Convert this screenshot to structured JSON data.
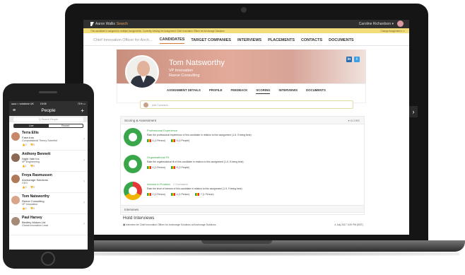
{
  "app": {
    "logo_prefix": "Aaron Wallis",
    "logo_accent": "Search",
    "user_name": "Caroline Richardson ▾",
    "notice": "This candidate is assigned to multiple Assignments. Currently viewing the Assignment Chief Innovation Officer for Anchorage Solutions",
    "change_assignment": "Change Assignment ▾",
    "close": "✕"
  },
  "nav": {
    "context": "Chief Innovation Officer for Anch...",
    "tabs": [
      "CANDIDATES",
      "TARGET COMPANIES",
      "INTERVIEWS",
      "PLACEMENTS",
      "CONTACTS",
      "DOCUMENTS"
    ]
  },
  "profile": {
    "name": "Tom Natsworthy",
    "role": "VP Innovation",
    "company": "Reeve Consulting",
    "linkedin": "in",
    "twitter": "t",
    "tabs": [
      "ASSIGNMENT DETAILS",
      "PROFILE",
      "FEEDBACK",
      "SCORING",
      "INTERVIEWS",
      "DOCUMENTS"
    ],
    "comment_placeholder": "Add Comment..."
  },
  "scoring": {
    "title": "Scoring & Assessment",
    "score_label": "▾ SCORE",
    "rows": [
      {
        "title": "Professional Experience",
        "extra": "",
        "desc": "Rate the professional experience of this candidate in relation to this assignment (1-5, 5 being best)",
        "votes": [
          "4 (1 Person)",
          "5 (2 People)"
        ]
      },
      {
        "title": "Organisational Fit",
        "extra": "",
        "desc": "Rate the organisational fit of this candidate in relation to this assignment (1-5, 5 being best)",
        "votes": [
          "4 (1 Person)",
          "5 (2 People)"
        ]
      },
      {
        "title": "Interest in Position",
        "extra": "1 Comment",
        "desc": "Rate the level of interest of this candidate in relation to this assignment (1-9, 9 being best)",
        "votes": [
          "2 (1 Person)",
          "4 (1 Person)",
          "7 (1 Person)"
        ]
      }
    ],
    "colors": [
      "#3aa64a",
      "#f0b400",
      "#e53935"
    ]
  },
  "interviews": {
    "title": "Interviews",
    "hold_title": "Hold Interviews",
    "row_text": "Interview for Chief Innovation Officer for Anchorage Solutions at Anchorage Solutions",
    "row_date": "4 July 2017 3:00 PM (BST)"
  },
  "mobile": {
    "carrier": "●●●○○ vodafone UK",
    "time": "15:06",
    "battery": "71% ▭",
    "title": "People",
    "search_placeholder": "Q Search People",
    "seg_live": "Live",
    "seg_recent": "Recent",
    "people": [
      {
        "name": "Terra Ellis",
        "company": "Fase-tras",
        "role": "Computational Theory Scientist",
        "votes": [
          "0",
          "0"
        ],
        "color": "#c7876a"
      },
      {
        "name": "Anthony Bennett",
        "company": "Night Vale Inc",
        "role": "VP Engineering",
        "votes": [
          "1",
          "0"
        ],
        "color": "#8a6a55"
      },
      {
        "name": "Freya Rasmussen",
        "company": "Anchorage Solutions",
        "role": "CEO",
        "votes": [
          "0",
          "0"
        ],
        "color": "#b07a5a"
      },
      {
        "name": "Tom Natsworthy",
        "company": "Reeve Consulting",
        "role": "VP Innovation",
        "votes": [
          "0",
          "0"
        ],
        "color": "#d8a48a"
      },
      {
        "name": "Paul Harvey",
        "company": "Bentley Motors Ltd",
        "role": "Global Innovation Lead",
        "votes": [
          "0",
          "0"
        ],
        "color": "#a58a78"
      }
    ]
  }
}
